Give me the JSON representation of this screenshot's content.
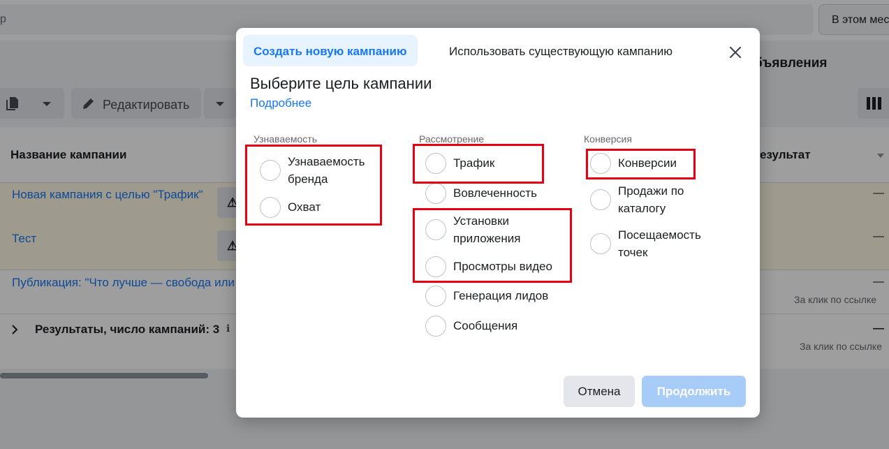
{
  "background": {
    "search_placeholder_tail": "р",
    "period_button": "В этом мес",
    "ads_tab": "бъявления",
    "edit_button": "Редактировать",
    "table_header_name": "Название кампании",
    "table_header_result": "езультат",
    "campaigns": [
      {
        "name": "Новая кампания с целью \"Трафик\""
      },
      {
        "name": "Тест"
      },
      {
        "name": "Публикация: \"Что лучше — свобода или"
      }
    ],
    "dash": "—",
    "per_click_note": "За клик по ссылке",
    "totals_row": "Результаты, число кампаний: 3",
    "warning_glyph": "⚠",
    "info_glyph": "ℹ"
  },
  "dialog": {
    "tabs": [
      "Создать новую кампанию",
      "Использовать существующую кампанию"
    ],
    "title": "Выберите цель кампании",
    "more_link": "Подробнее",
    "columns": [
      {
        "heading": "Узнаваемость",
        "options": [
          "Узнаваемость бренда",
          "Охват"
        ]
      },
      {
        "heading": "Рассмотрение",
        "options": [
          "Трафик",
          "Вовлеченность",
          "Установки приложения",
          "Просмотры видео",
          "Генерация лидов",
          "Сообщения"
        ]
      },
      {
        "heading": "Конверсия",
        "options": [
          "Конверсии",
          "Продажи по каталогу",
          "Посещаемость точек"
        ]
      }
    ],
    "cancel_button": "Отмена",
    "continue_button": "Продолжить"
  },
  "colors": {
    "accent": "#1877f2",
    "highlight_box": "#e60012",
    "continue_disabled": "#a7ccf7"
  }
}
